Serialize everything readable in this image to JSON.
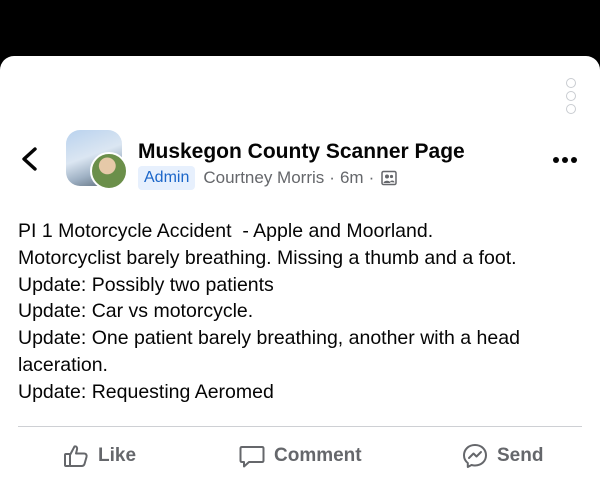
{
  "post": {
    "group_name": "Muskegon County Scanner Page",
    "badge": "Admin",
    "author": "Courtney Morris",
    "separator": "·",
    "time": "6m",
    "body_lines": [
      "PI 1 Motorcycle Accident  - Apple and Moorland.",
      "Motorcyclist barely breathing. Missing a thumb and a foot.",
      "Update: Possibly two patients",
      "Update: Car vs motorcycle.",
      "Update: One patient barely breathing, another with a head",
      "laceration.",
      "Update: Requesting Aeromed"
    ]
  },
  "actions": {
    "like": "Like",
    "comment": "Comment",
    "send": "Send"
  },
  "icons": {
    "back": "chevron-left-icon",
    "more": "more-horizontal-icon",
    "audience": "group-audience-icon",
    "like": "thumbs-up-icon",
    "comment": "comment-bubble-icon",
    "send": "messenger-icon"
  },
  "colors": {
    "admin_badge_bg": "#e7f0fd",
    "admin_badge_text": "#1b66c9",
    "secondary_text": "#65676b"
  }
}
